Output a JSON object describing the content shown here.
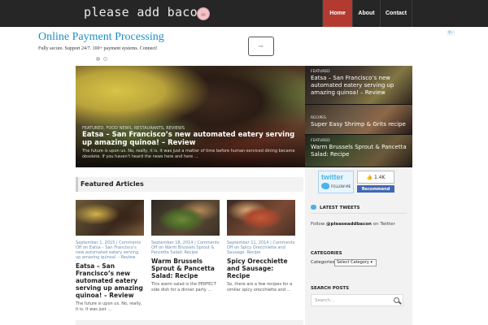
{
  "header": {
    "logo_text": "please add bacon",
    "nav": [
      {
        "label": "Home",
        "active": true
      },
      {
        "label": "About",
        "active": false
      },
      {
        "label": "Contact",
        "active": false
      }
    ],
    "colors": {
      "topbar": "#262626",
      "active_nav": "#b23a31"
    }
  },
  "ad": {
    "title": "Online Payment Processing",
    "subtitle": "Fully secure. Support 24/7. 100+ payment systems. Connect!",
    "button_icon": "arrow-right-icon",
    "corner_badge": "i▷",
    "title_color": "#1a8fc9"
  },
  "slider": {
    "main": {
      "categories": "Featured, Food News, Restaurants, Reviews",
      "title": "Eatsa – San Francisco’s new automated eatery serving up amazing quinoa! – Review",
      "excerpt": "The future is upon us. No, really, it is. It was just a matter of time before human-serviced dining became obsolete. If you haven’t heard the news here and here ..."
    },
    "side": [
      {
        "category": "Featured",
        "title": "Eatsa – San Francisco’s new automated eatery serving up amazing quinoa! – Review"
      },
      {
        "category": "Recipes",
        "title": "Super Easy Shrimp & Grits recipe"
      },
      {
        "category": "Featured",
        "title": "Warm Brussels Sprout & Pancetta Salad: Recipe"
      }
    ]
  },
  "featured": {
    "heading": "Featured Articles",
    "cards": [
      {
        "meta": "September 1, 2015 | Comments Off on Eatsa – San Francisco’s new automated eatery serving up amazing quinoa! – Review",
        "title": "Eatsa – San Francisco’s new automated eatery serving up amazing quinoa! – Review",
        "excerpt": "The future is upon us. No, really, it is. It was just ..."
      },
      {
        "meta": "September 18, 2014 | Comments Off on Warm Brussels Sprout & Pancetta Salad: Recipe",
        "title": "Warm Brussels Sprout & Pancetta Salad: Recipe",
        "excerpt": "This warm salad is the PERFECT side dish for a dinner party ..."
      },
      {
        "meta": "September 11, 2014 | Comments Off on Spicy Orecchiette and Sausage: Recipe",
        "title": "Spicy Orecchiette and Sausage: Recipe",
        "excerpt": "So, there are a few recipes for a similar spicy orecchiette and ..."
      }
    ]
  },
  "sidebar": {
    "twitter_badge": {
      "word": "twitter",
      "follow": "FOLLOW ME"
    },
    "like_count": "1.4K",
    "recommend_label": "Recommend",
    "latest_tweets_title": "Latest Tweets",
    "follow_prefix": "Follow ",
    "follow_handle": "@pleaseaddbacon",
    "follow_suffix": " on Twitter",
    "categories_title": "Categories",
    "categories_label": "Categories",
    "categories_select": "Select Category",
    "search_title": "Search Posts",
    "search_placeholder": "Search..."
  }
}
